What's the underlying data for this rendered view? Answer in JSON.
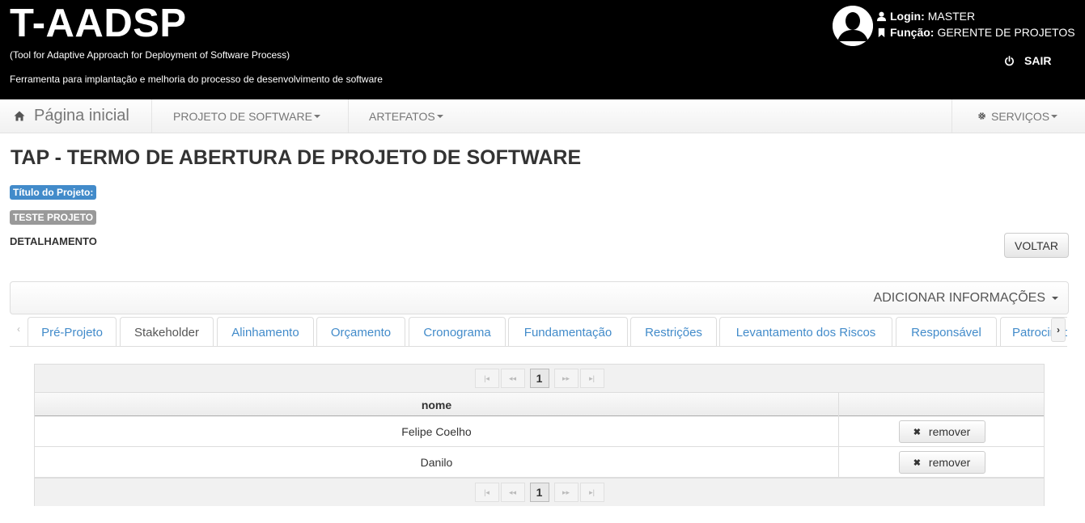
{
  "header": {
    "title": "T-AADSP",
    "subtitle1": "(Tool for Adaptive Approach for Deployment of Software Process)",
    "subtitle2": "Ferramenta para implantação e melhoria do processo de desenvolvimento de software",
    "login_label": "Login:",
    "login_value": "MASTER",
    "role_label": "Função:",
    "role_value": "GERENTE DE PROJETOS",
    "logout_label": "SAIR"
  },
  "navbar": {
    "home_label": "Página inicial",
    "items": [
      "PROJETO DE SOFTWARE",
      "ARTEFATOS"
    ],
    "services_label": "SERVIÇOS"
  },
  "page": {
    "title": "TAP - TERMO DE ABERTURA DE PROJETO DE SOFTWARE",
    "project_title_label": "Título do Projeto:",
    "project_name": "TESTE PROJETO",
    "section_label": "DETALHAMENTO",
    "back_button": "VOLTAR",
    "add_info_label": "ADICIONAR INFORMAÇÕES"
  },
  "tabs": [
    "Pré-Projeto",
    "Stakeholder",
    "Alinhamento",
    "Orçamento",
    "Cronograma",
    "Fundamentação",
    "Restrições",
    "Levantamento dos Riscos",
    "Responsável",
    "Patrocinador"
  ],
  "active_tab": "Stakeholder",
  "table": {
    "page_current": "1",
    "columns": [
      "nome",
      ""
    ],
    "rows": [
      {
        "nome": "Felipe Coelho",
        "action": "remover"
      },
      {
        "nome": "Danilo",
        "action": "remover"
      }
    ]
  },
  "icons": {
    "home": "home-icon",
    "user": "user-icon",
    "bookmark": "bookmark-icon",
    "power": "power-icon",
    "gear": "gear-icon",
    "remove": "close-icon"
  }
}
